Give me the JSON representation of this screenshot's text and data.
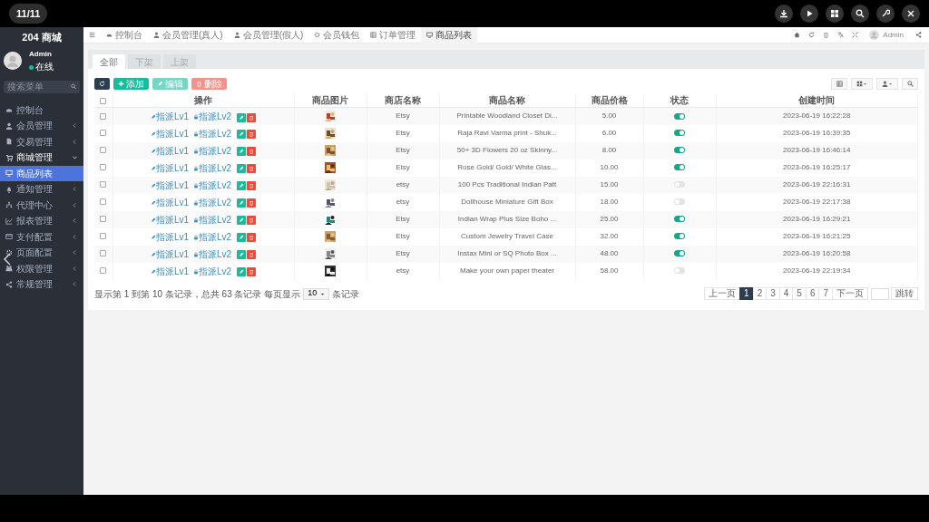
{
  "viewer": {
    "counter": "11/11"
  },
  "sidebar": {
    "brand": "204 商城",
    "user": {
      "name": "Admin",
      "status": "在线"
    },
    "search": {
      "placeholder": "搜索菜单"
    },
    "items": [
      {
        "label": "控制台",
        "selected": false
      },
      {
        "label": "会员管理",
        "selected": false,
        "expanded": false
      },
      {
        "label": "交易管理",
        "selected": false,
        "expanded": false
      },
      {
        "label": "商城管理",
        "selected": false,
        "expanded": true,
        "children": [
          {
            "label": "商品列表",
            "selected": true
          }
        ]
      },
      {
        "label": "通知管理",
        "selected": false,
        "expanded": false
      },
      {
        "label": "代理中心",
        "selected": false,
        "expanded": false
      },
      {
        "label": "报表管理",
        "selected": false,
        "expanded": false
      },
      {
        "label": "支付配置",
        "selected": false,
        "expanded": false
      },
      {
        "label": "页面配置",
        "selected": false,
        "expanded": false
      },
      {
        "label": "权限管理",
        "selected": false,
        "expanded": false
      },
      {
        "label": "常规管理",
        "selected": false,
        "expanded": false
      }
    ]
  },
  "tabs": [
    {
      "label": "控制台",
      "selected": false
    },
    {
      "label": "会员管理(真人)",
      "selected": false
    },
    {
      "label": "会员管理(假人)",
      "selected": false
    },
    {
      "label": "会员钱包",
      "selected": false
    },
    {
      "label": "订单管理",
      "selected": false
    },
    {
      "label": "商品列表",
      "selected": true
    }
  ],
  "header": {
    "user": "Admin"
  },
  "filter_tabs": [
    {
      "label": "全部",
      "selected": true
    },
    {
      "label": "下架",
      "selected": false
    },
    {
      "label": "上架",
      "selected": false
    }
  ],
  "toolbar": [
    {
      "kind": "refresh",
      "disabled": false
    },
    {
      "kind": "add",
      "label": "添加",
      "disabled": false
    },
    {
      "kind": "edit",
      "label": "编辑",
      "disabled": true
    },
    {
      "kind": "delete",
      "label": "删除",
      "disabled": true
    }
  ],
  "table": {
    "select_all_checked": false,
    "columns": [
      "操作",
      "商品图片",
      "商店名称",
      "商品名称",
      "商品价格",
      "状态",
      "创建时间"
    ],
    "rows": [
      {
        "checked": false,
        "actions": [
          "指派Lv1",
          "指派Lv2"
        ],
        "store": "Etsy",
        "name": "Printable Woodland Closet Di...",
        "price": "5.00",
        "on": true,
        "created": "2023-06-19 16:22:28"
      },
      {
        "checked": false,
        "actions": [
          "指派Lv1",
          "指派Lv2"
        ],
        "store": "Etsy",
        "name": "Raja Ravi Varma print - Shuk...",
        "price": "6.00",
        "on": true,
        "created": "2023-06-19 16:39:35"
      },
      {
        "checked": false,
        "actions": [
          "指派Lv1",
          "指派Lv2"
        ],
        "store": "Etsy",
        "name": "50+ 3D Flowers 20 oz Skinny...",
        "price": "8.00",
        "on": true,
        "created": "2023-06-19 16:46:14"
      },
      {
        "checked": false,
        "actions": [
          "指派Lv1",
          "指派Lv2"
        ],
        "store": "Etsy",
        "name": "Rose Gold/ Gold/ White Glas...",
        "price": "10.00",
        "on": true,
        "created": "2023-06-19 16:25:17"
      },
      {
        "checked": false,
        "actions": [
          "指派Lv1",
          "指派Lv2"
        ],
        "store": "etsy",
        "name": "100 Pcs Traditional Indian Patt",
        "price": "15.00",
        "on": false,
        "created": "2023-06-19 22:16:31"
      },
      {
        "checked": false,
        "actions": [
          "指派Lv1",
          "指派Lv2"
        ],
        "store": "etsy",
        "name": "Dollhouse Miniature Gift Box",
        "price": "18.00",
        "on": false,
        "created": "2023-06-19 22:17:38"
      },
      {
        "checked": false,
        "actions": [
          "指派Lv1",
          "指派Lv2"
        ],
        "store": "Etsy",
        "name": "Indian Wrap Plus Size Boho ...",
        "price": "25.00",
        "on": true,
        "created": "2023-06-19 16:29:21"
      },
      {
        "checked": false,
        "actions": [
          "指派Lv1",
          "指派Lv2"
        ],
        "store": "Etsy",
        "name": "Custom Jewelry Travel Case",
        "price": "32.00",
        "on": true,
        "created": "2023-06-19 16:21:25"
      },
      {
        "checked": false,
        "actions": [
          "指派Lv1",
          "指派Lv2"
        ],
        "store": "Etsy",
        "name": "Instax Mini or SQ Photo Box ...",
        "price": "48.00",
        "on": true,
        "created": "2023-06-19 16:20:58"
      },
      {
        "checked": false,
        "actions": [
          "指派Lv1",
          "指派Lv2"
        ],
        "store": "etsy",
        "name": "Make your own paper theater",
        "price": "58.00",
        "on": false,
        "created": "2023-06-19 22:19:34"
      }
    ]
  },
  "footer": {
    "info": "显示第 1 到第 10 条记录，总共 63 条记录 每页显示",
    "page_size": "10",
    "suffix": "条记录",
    "pages": [
      {
        "label": "上一页",
        "selected": false
      },
      {
        "label": "1",
        "selected": true
      },
      {
        "label": "2",
        "selected": false
      },
      {
        "label": "3",
        "selected": false
      },
      {
        "label": "4",
        "selected": false
      },
      {
        "label": "5",
        "selected": false
      },
      {
        "label": "6",
        "selected": false
      },
      {
        "label": "7",
        "selected": false
      },
      {
        "label": "下一页",
        "selected": false
      }
    ],
    "jump": "跳转"
  }
}
